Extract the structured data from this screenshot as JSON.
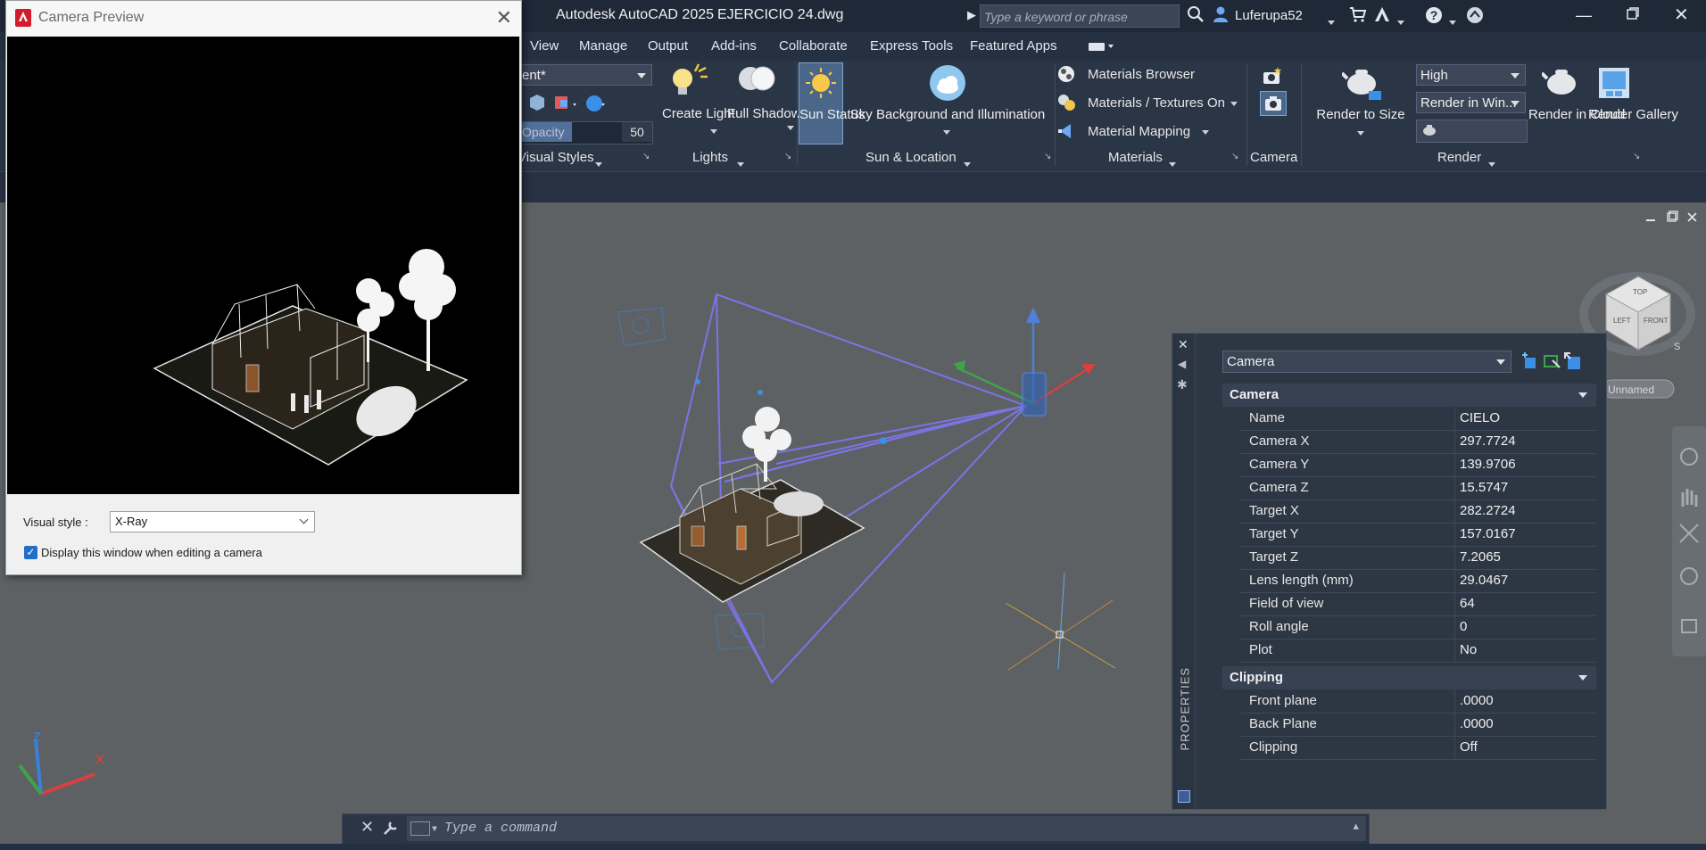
{
  "window": {
    "app_title": "Autodesk AutoCAD 2025",
    "file_name": "EJERCICIO 24.dwg",
    "search_placeholder": "Type a keyword or phrase",
    "user": "Luferupa52"
  },
  "tabs": [
    "View",
    "Manage",
    "Output",
    "Add-ins",
    "Collaborate",
    "Express Tools",
    "Featured Apps"
  ],
  "ribbon": {
    "visual_styles": {
      "dropdown_value": "ent*",
      "opacity_label": "Opacity",
      "opacity_value": "50",
      "panel": "Visual Styles"
    },
    "lights": {
      "create_light": "Create Light",
      "full_shadows": "Full Shadows",
      "panel": "Lights"
    },
    "sun": {
      "sun_status": "Sun Status",
      "sky": "Sky Background and Illumination",
      "panel": "Sun & Location"
    },
    "materials": {
      "browser": "Materials Browser",
      "textures": "Materials / Textures On",
      "mapping": "Material Mapping",
      "panel": "Materials"
    },
    "camera": {
      "panel": "Camera"
    },
    "render": {
      "render_to_size": "Render to Size",
      "quality": "High",
      "render_in": "Render in Win...",
      "render_cloud": "Render in Cloud",
      "render_gallery": "Render Gallery",
      "panel": "Render"
    }
  },
  "preview": {
    "title": "Camera Preview",
    "visual_style_label": "Visual style :",
    "visual_style_value": "X-Ray",
    "display_checkbox": "Display this window when editing a camera",
    "display_checked": true
  },
  "viewcube": {
    "top": "TOP",
    "left": "LEFT",
    "front": "FRONT",
    "compass_s": "S",
    "wcs_badge": "Unnamed"
  },
  "properties": {
    "vertical_title": "PROPERTIES",
    "object_type": "Camera",
    "sections": [
      {
        "title": "Camera",
        "rows": [
          {
            "key": "Name",
            "value": "CIELO"
          },
          {
            "key": "Camera X",
            "value": "297.7724"
          },
          {
            "key": "Camera Y",
            "value": "139.9706"
          },
          {
            "key": "Camera Z",
            "value": "15.5747"
          },
          {
            "key": "Target X",
            "value": "282.2724"
          },
          {
            "key": "Target Y",
            "value": "157.0167"
          },
          {
            "key": "Target Z",
            "value": "7.2065"
          },
          {
            "key": "Lens length (mm)",
            "value": "29.0467"
          },
          {
            "key": "Field of view",
            "value": "64"
          },
          {
            "key": "Roll angle",
            "value": "0"
          },
          {
            "key": "Plot",
            "value": "No"
          }
        ]
      },
      {
        "title": "Clipping",
        "rows": [
          {
            "key": "Front plane",
            "value": ".0000"
          },
          {
            "key": "Back Plane",
            "value": ".0000"
          },
          {
            "key": "Clipping",
            "value": "Off"
          }
        ]
      }
    ]
  },
  "command": {
    "placeholder": "Type a command"
  },
  "colors": {
    "viewport": "#5d6163",
    "ribbon": "#2a3545",
    "titlebar": "#1e2837",
    "camera_frustum": "#7b74e6",
    "accent_blue": "#1f6fc9"
  }
}
